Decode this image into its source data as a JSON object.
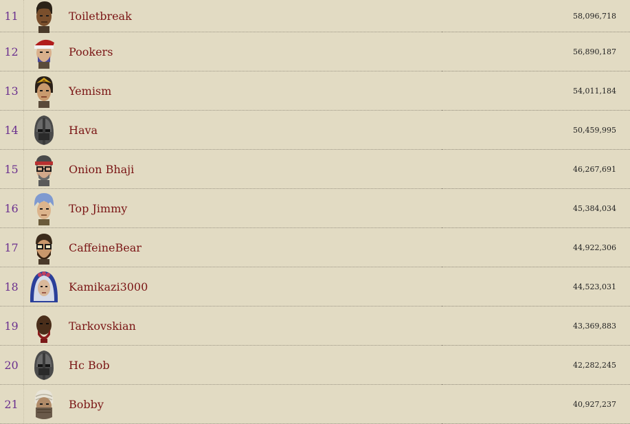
{
  "rows": [
    {
      "rank": "11",
      "name": "Toiletbreak",
      "score": "58,096,718",
      "avatar_icon": "dark-haired-head-icon"
    },
    {
      "rank": "12",
      "name": "Pookers",
      "score": "56,890,187",
      "avatar_icon": "santa-hat-head-icon"
    },
    {
      "rank": "13",
      "name": "Yemism",
      "score": "54,011,184",
      "avatar_icon": "tiara-head-icon"
    },
    {
      "rank": "14",
      "name": "Hava",
      "score": "50,459,995",
      "avatar_icon": "iron-helm-icon"
    },
    {
      "rank": "15",
      "name": "Onion Bhaji",
      "score": "46,267,691",
      "avatar_icon": "headband-glasses-head-icon"
    },
    {
      "rank": "16",
      "name": "Top Jimmy",
      "score": "45,384,034",
      "avatar_icon": "blue-haired-head-icon"
    },
    {
      "rank": "17",
      "name": "CaffeineBear",
      "score": "44,922,306",
      "avatar_icon": "glasses-bearded-head-icon"
    },
    {
      "rank": "18",
      "name": "Kamikazi3000",
      "score": "44,523,031",
      "avatar_icon": "blue-hood-head-icon"
    },
    {
      "rank": "19",
      "name": "Tarkovskian",
      "score": "43,369,883",
      "avatar_icon": "red-bearded-head-icon"
    },
    {
      "rank": "20",
      "name": "Hc Bob",
      "score": "42,282,245",
      "avatar_icon": "iron-helm-icon"
    },
    {
      "rank": "21",
      "name": "Bobby",
      "score": "40,927,237",
      "avatar_icon": "turban-mask-head-icon"
    }
  ]
}
